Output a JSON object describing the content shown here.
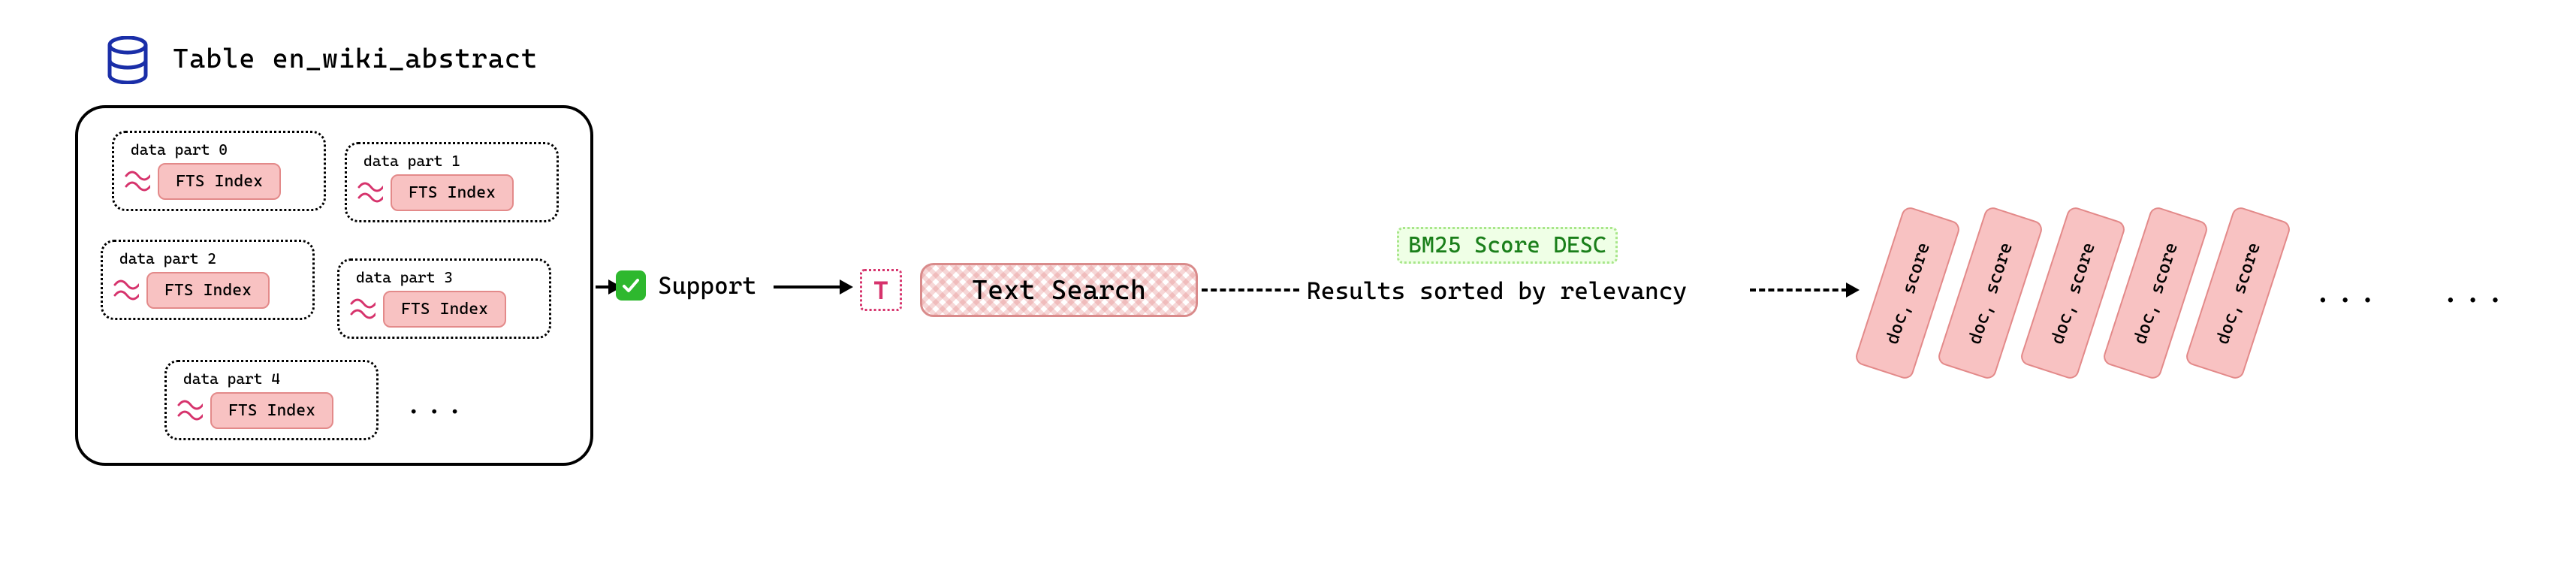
{
  "table": {
    "title": "Table en_wiki_abstract",
    "parts": [
      {
        "label": "data part 0",
        "chip": "FTS Index"
      },
      {
        "label": "data part 1",
        "chip": "FTS Index"
      },
      {
        "label": "data part 2",
        "chip": "FTS Index"
      },
      {
        "label": "data part 3",
        "chip": "FTS Index"
      },
      {
        "label": "data part 4",
        "chip": "FTS Index"
      }
    ],
    "ellipsis": "..."
  },
  "support": {
    "label": "Support"
  },
  "text_search": {
    "icon_letter": "T",
    "label": "Text Search"
  },
  "score_hint": {
    "label": "BM25 Score DESC"
  },
  "results": {
    "label": "Results sorted by relevancy"
  },
  "cards": [
    {
      "text": "doc, score"
    },
    {
      "text": "doc, score"
    },
    {
      "text": "doc, score"
    },
    {
      "text": "doc, score"
    },
    {
      "text": "doc, score"
    }
  ],
  "end_dots_1": "...",
  "end_dots_2": "..."
}
